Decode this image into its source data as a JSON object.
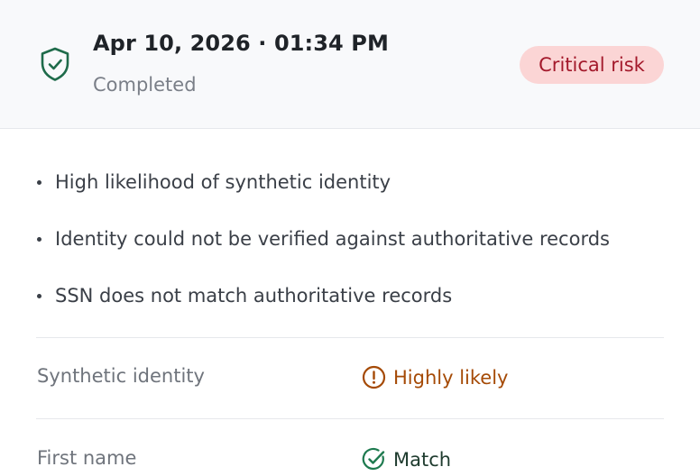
{
  "header": {
    "title": "Apr 10, 2026 · 01:34 PM",
    "status": "Completed",
    "risk_badge": "Critical risk",
    "shield_icon": "shield-check-icon"
  },
  "reasons": [
    "High likelihood of synthetic identity",
    "Identity could not be verified against authoritative records",
    "SSN does not match authoritative records"
  ],
  "rows": [
    {
      "label": "Synthetic identity",
      "value": "Highly likely",
      "icon": "alert-circle-icon"
    },
    {
      "label": "First name",
      "value": "Match",
      "icon": "check-circle-icon"
    }
  ],
  "colors": {
    "shield": "#1e6b4a",
    "badge_bg": "#fbd5d5",
    "badge_text": "#a3192b",
    "warning": "#a54a06",
    "match": "#1e3b2e",
    "match_icon": "#1e7a4f"
  }
}
